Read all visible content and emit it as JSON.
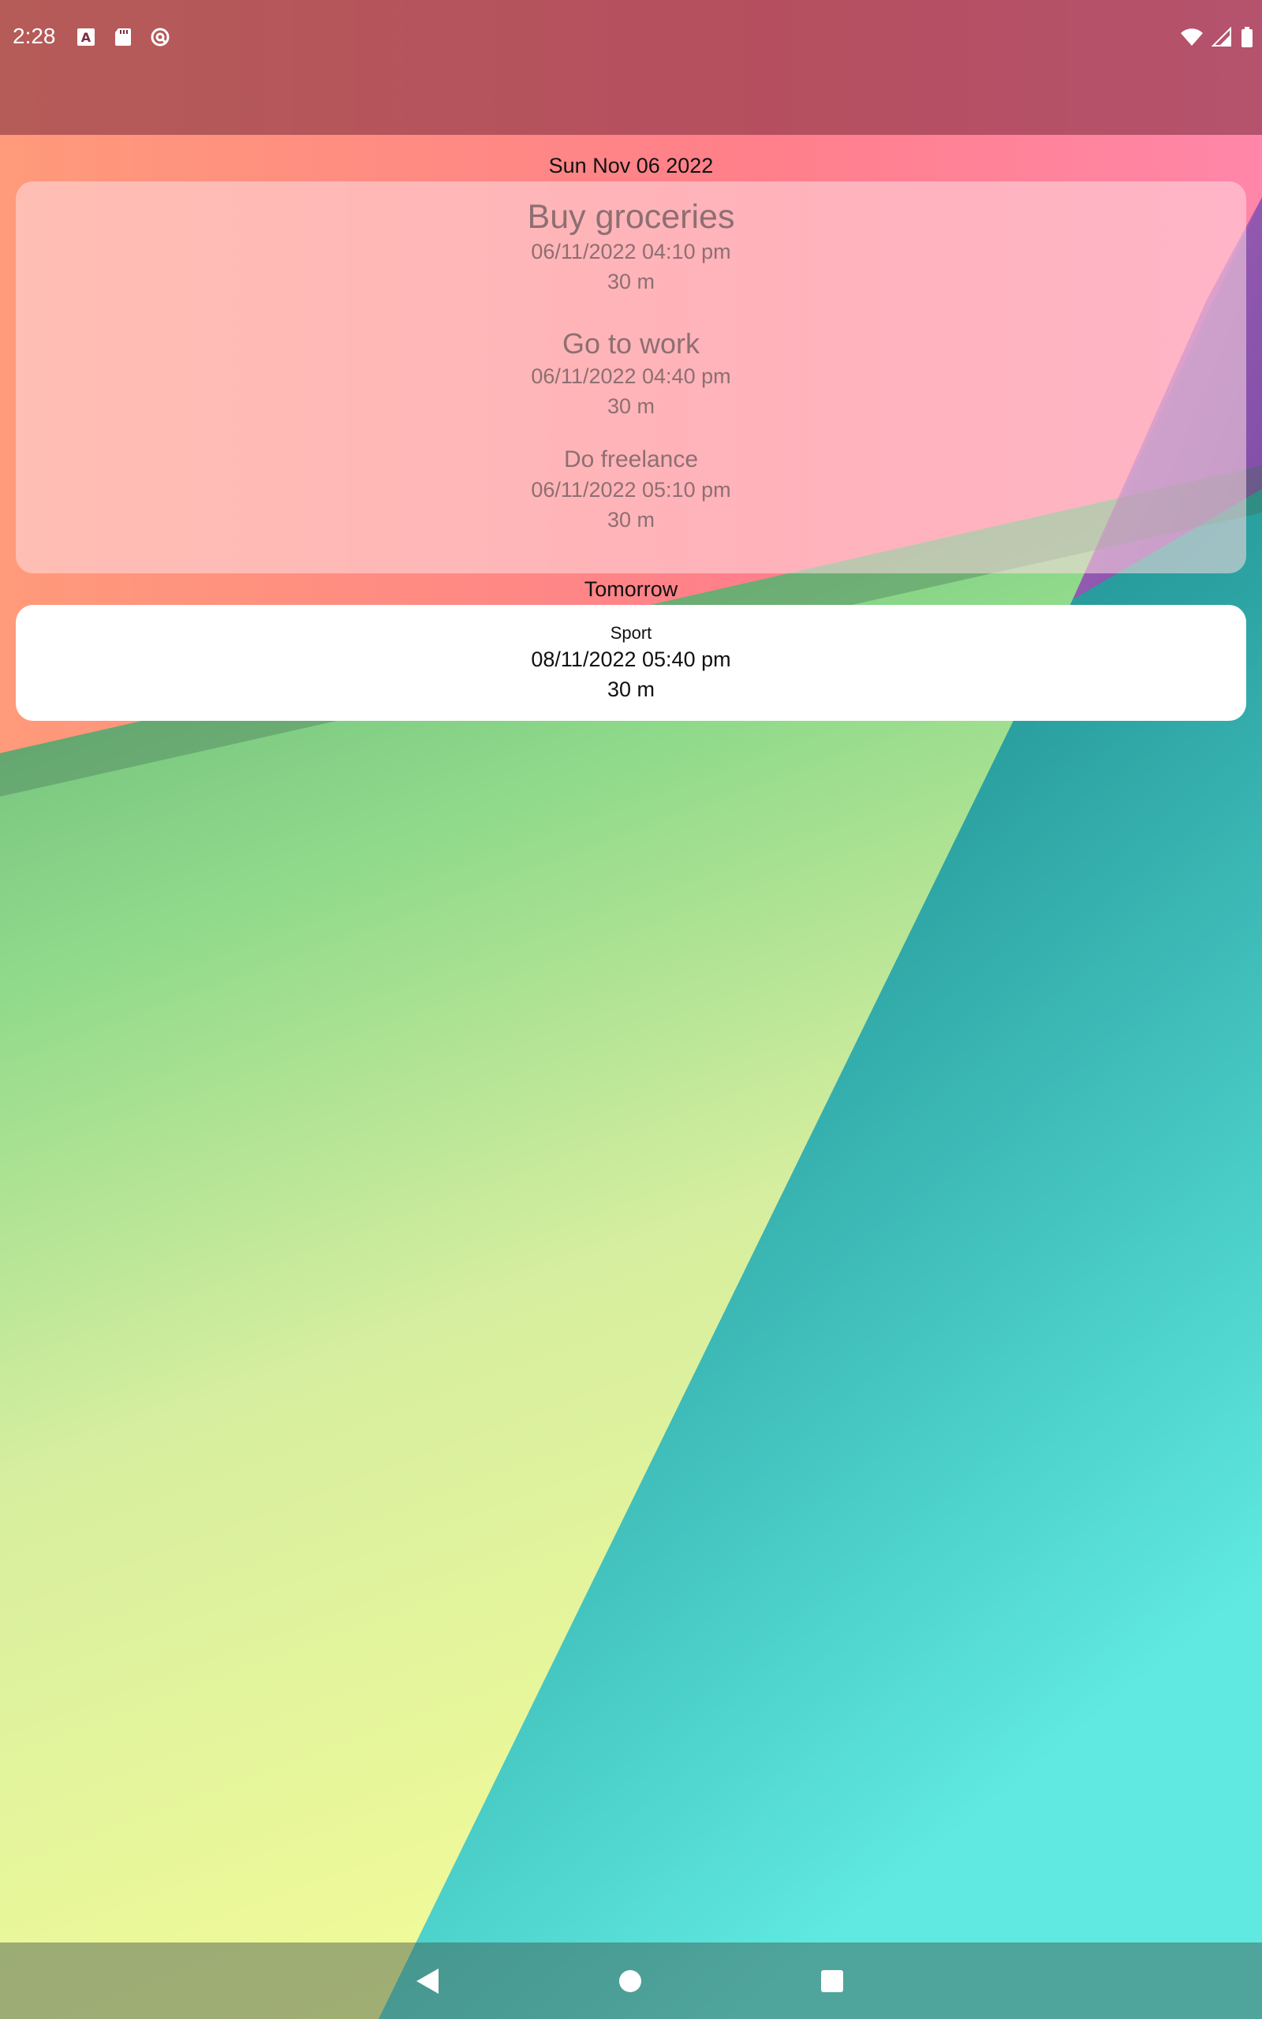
{
  "status_bar": {
    "time": "2:28",
    "icons_left": [
      "font-a-icon",
      "sd-card-icon",
      "sync-icon"
    ],
    "icons_right": [
      "wifi-icon",
      "signal-icon",
      "battery-icon"
    ]
  },
  "widget": {
    "sections": [
      {
        "header": "Sun Nov 06 2022",
        "events": [
          {
            "title": "Buy groceries",
            "datetime": "06/11/2022 04:10 pm",
            "duration": "30 m"
          },
          {
            "title": "Go to work",
            "datetime": "06/11/2022 04:40 pm",
            "duration": "30 m"
          },
          {
            "title": "Do freelance",
            "datetime": "06/11/2022 05:10 pm",
            "duration": "30 m"
          }
        ]
      },
      {
        "header": "Tomorrow",
        "events": [
          {
            "title": "Sport",
            "datetime": "08/11/2022 05:40 pm",
            "duration": "30 m"
          }
        ]
      }
    ]
  },
  "nav_bar": {
    "buttons": [
      "back-icon",
      "home-icon",
      "recents-icon"
    ]
  },
  "colors": {
    "wallpaper_pink": "#ff8a80",
    "wallpaper_green": "#8ed98a",
    "wallpaper_yellow": "#eef59a",
    "wallpaper_teal": "#2aa0a0",
    "card_text": "#8d6f72"
  }
}
